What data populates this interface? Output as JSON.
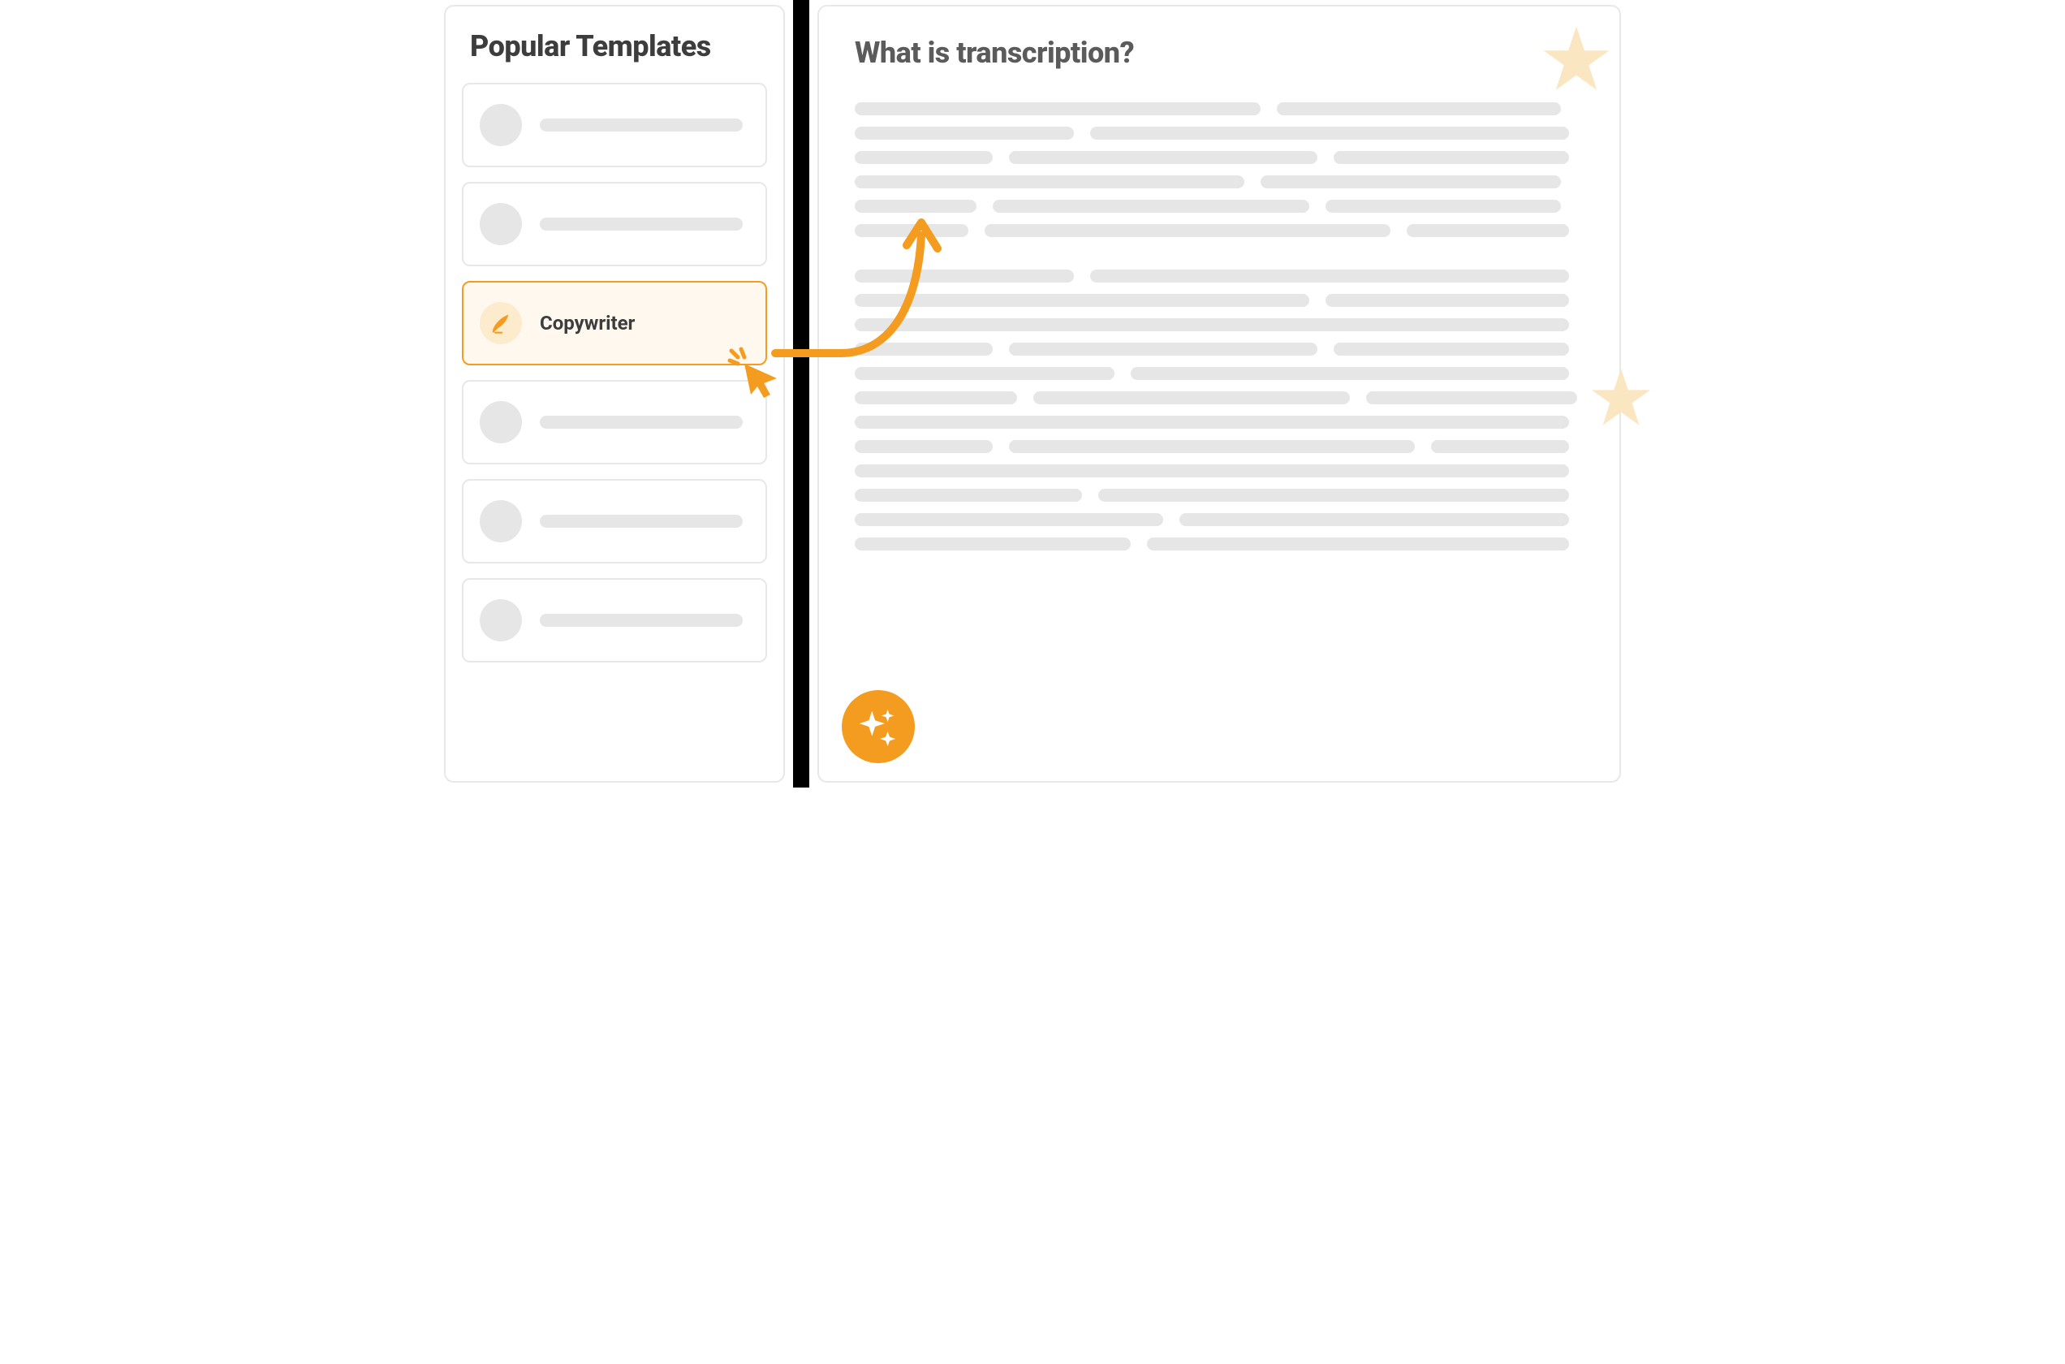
{
  "sidebar": {
    "title": "Popular Templates",
    "items": [
      {
        "label": "",
        "selected": false
      },
      {
        "label": "",
        "selected": false
      },
      {
        "label": "Copywriter",
        "selected": true
      },
      {
        "label": "",
        "selected": false
      },
      {
        "label": "",
        "selected": false
      },
      {
        "label": "",
        "selected": false
      }
    ]
  },
  "content": {
    "title": "What is transcription?"
  },
  "colors": {
    "accent": "#f39c1f",
    "accent_bg": "#fff8ef",
    "avatar_tint": "#fdebce",
    "skeleton": "#e6e6e6",
    "text_dark": "#3d3d3d",
    "text_muted": "#5b5b5b",
    "border": "#e8e8e8",
    "divider": "#000000",
    "star_light": "#fbe6c2"
  },
  "icons": {
    "quill": "quill-icon",
    "cursor": "cursor-click-icon",
    "arrow": "curved-arrow-icon",
    "sparkle_badge": "sparkle-badge-icon",
    "star1": "star-icon",
    "star2": "star-icon"
  }
}
